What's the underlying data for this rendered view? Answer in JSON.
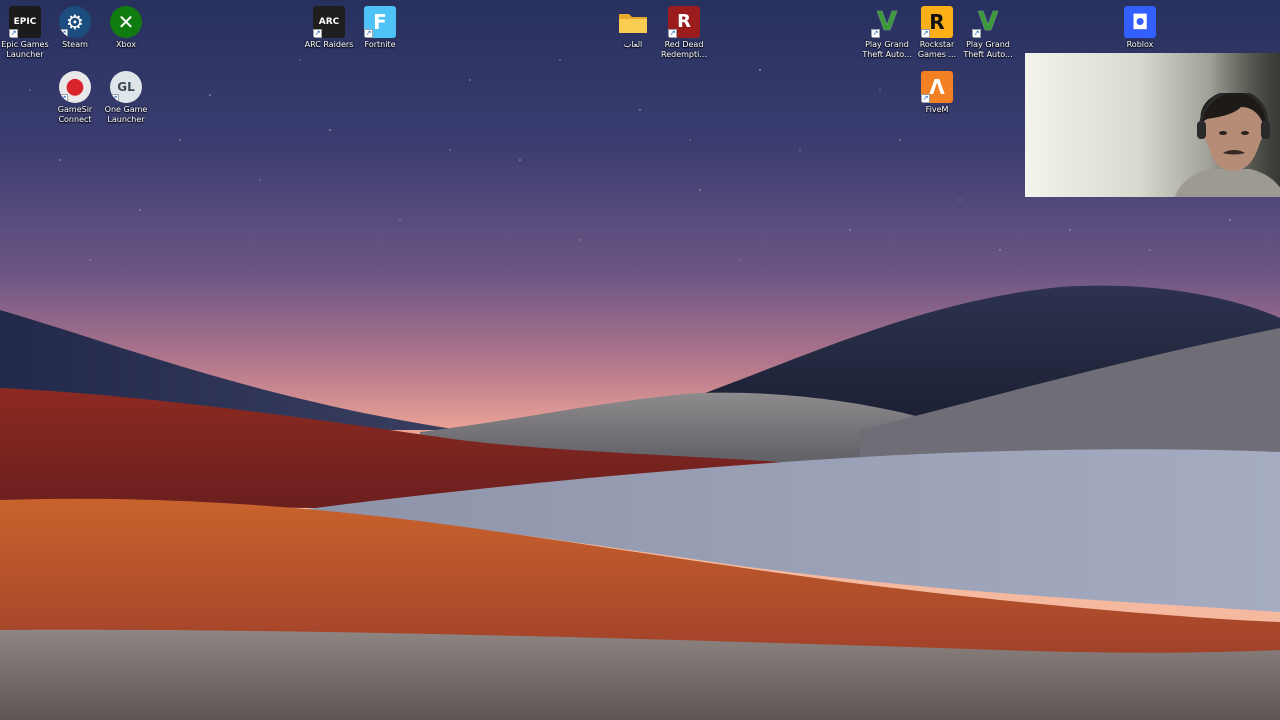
{
  "desktop": {
    "icons": [
      {
        "id": "epic",
        "label": "Epic Games Launcher",
        "icon": "epic-games-icon",
        "glyph": "EPIC",
        "bg": "#1b1b1b",
        "fg": "#ffffff",
        "shortcut": true
      },
      {
        "id": "steam",
        "label": "Steam",
        "icon": "steam-icon",
        "glyph": "⚙",
        "bg": "#1b4d7e",
        "fg": "#ffffff",
        "shortcut": true
      },
      {
        "id": "xbox",
        "label": "Xbox",
        "icon": "xbox-icon",
        "glyph": "✕",
        "bg": "#107c10",
        "fg": "#ffffff",
        "shortcut": false
      },
      {
        "id": "gamesir",
        "label": "GameSir Connect",
        "icon": "gamesir-icon",
        "glyph": "●",
        "bg": "#e8e8e8",
        "fg": "#d9232d",
        "shortcut": true
      },
      {
        "id": "onegame",
        "label": "One Game Launcher",
        "icon": "one-game-launcher-icon",
        "glyph": "GL",
        "bg": "#dfe6ea",
        "fg": "#3a4a54",
        "shortcut": true
      },
      {
        "id": "arc",
        "label": "ARC Raiders",
        "icon": "arc-raiders-icon",
        "glyph": "ARC",
        "bg": "#1e1e1e",
        "fg": "#ffffff",
        "shortcut": true
      },
      {
        "id": "fortnite",
        "label": "Fortnite",
        "icon": "fortnite-icon",
        "glyph": "F",
        "bg": "#4fc3f7",
        "fg": "#ffffff",
        "shortcut": true
      },
      {
        "id": "folder",
        "label": "العاب",
        "icon": "folder-icon",
        "glyph": "",
        "bg": "#f5c542",
        "fg": "#ffffff",
        "shortcut": false
      },
      {
        "id": "rdr",
        "label": "Red Dead Redempti...",
        "icon": "red-dead-redemption-icon",
        "glyph": "R",
        "bg": "#9b1c1c",
        "fg": "#ffffff",
        "shortcut": true
      },
      {
        "id": "gta1",
        "label": "Play Grand Theft Auto...",
        "icon": "gta-v-icon",
        "glyph": "V",
        "bg": "#ffffff",
        "fg": "#3c9a3c",
        "shortcut": true
      },
      {
        "id": "rockstar",
        "label": "Rockstar Games ...",
        "icon": "rockstar-games-icon",
        "glyph": "R",
        "bg": "#fcaf17",
        "fg": "#111111",
        "shortcut": true
      },
      {
        "id": "gta2",
        "label": "Play Grand Theft Auto...",
        "icon": "gta-v-icon",
        "glyph": "V",
        "bg": "#ffffff",
        "fg": "#3c9a3c",
        "shortcut": true
      },
      {
        "id": "fivem",
        "label": "FiveM",
        "icon": "fivem-icon",
        "glyph": "Λ",
        "bg": "#f48024",
        "fg": "#ffffff",
        "shortcut": true
      },
      {
        "id": "roblox",
        "label": "Roblox",
        "icon": "roblox-icon",
        "glyph": "◘",
        "bg": "#335fff",
        "fg": "#ffffff",
        "shortcut": false
      }
    ]
  }
}
